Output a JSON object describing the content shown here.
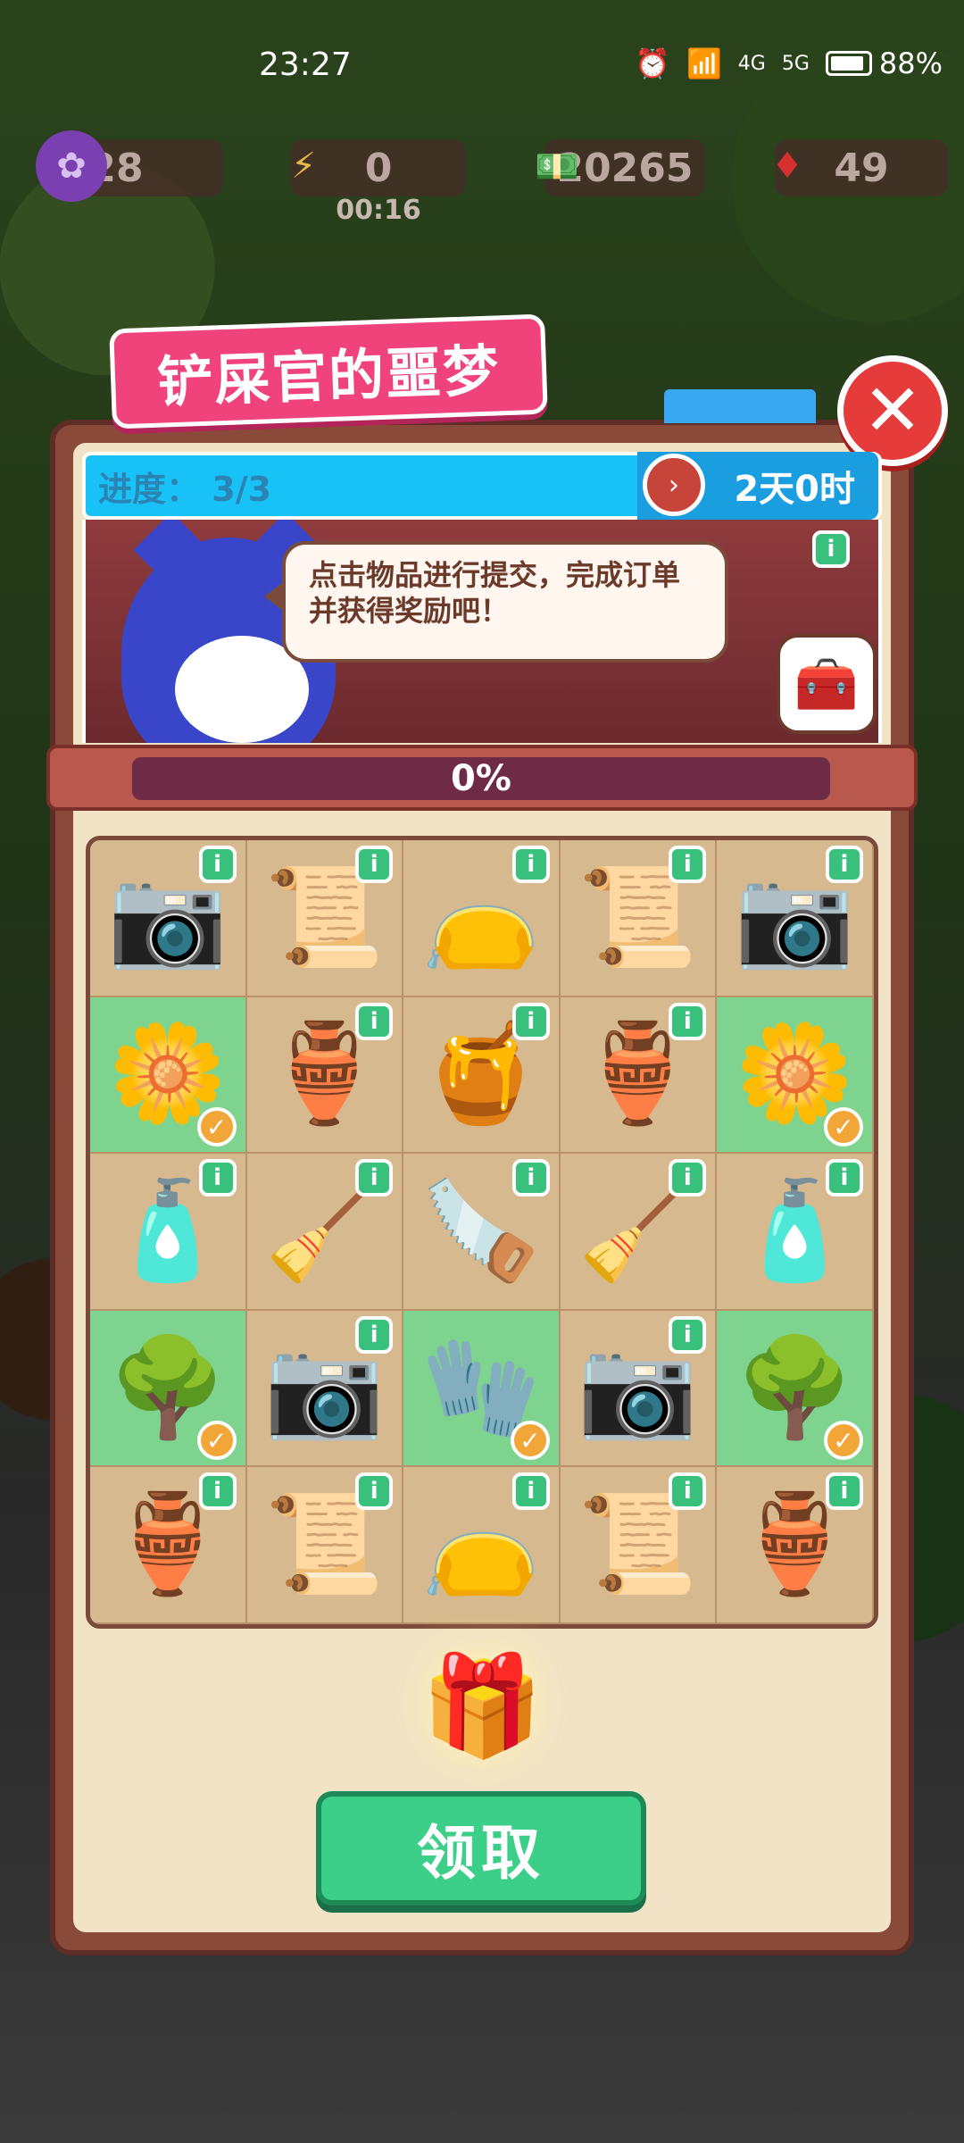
{
  "status_bar": {
    "time": "23:27",
    "network_labels": [
      "4G",
      "5G"
    ],
    "battery": "88%"
  },
  "resources": {
    "level": "28",
    "energy": "0",
    "energy_timer": "00:16",
    "cash": "20265",
    "gems": "49"
  },
  "event": {
    "title": "铲屎官的噩梦",
    "progress_label": "进度：",
    "progress_value": "3/3",
    "timer": "2天0时",
    "speech": "点击物品进行提交，完成订单并获得奖励吧！",
    "progress_percent": "0%"
  },
  "grid": {
    "rows": [
      [
        {
          "icon": "camera",
          "glyph": "📷",
          "done": false
        },
        {
          "icon": "poster",
          "glyph": "📜",
          "done": false
        },
        {
          "icon": "pouch",
          "glyph": "👝",
          "done": false
        },
        {
          "icon": "poster",
          "glyph": "📜",
          "done": false
        },
        {
          "icon": "camera",
          "glyph": "📷",
          "done": false
        }
      ],
      [
        {
          "icon": "cotton-flower",
          "glyph": "🌼",
          "done": true
        },
        {
          "icon": "vase",
          "glyph": "🏺",
          "done": false
        },
        {
          "icon": "honey-jar",
          "glyph": "🍯",
          "done": false
        },
        {
          "icon": "vase",
          "glyph": "🏺",
          "done": false
        },
        {
          "icon": "cotton-flower",
          "glyph": "🌼",
          "done": true
        }
      ],
      [
        {
          "icon": "soap-bottle",
          "glyph": "🧴",
          "done": false
        },
        {
          "icon": "broom",
          "glyph": "🧹",
          "done": false
        },
        {
          "icon": "hacksaw",
          "glyph": "🪚",
          "done": false
        },
        {
          "icon": "broom",
          "glyph": "🧹",
          "done": false
        },
        {
          "icon": "soap-bottle",
          "glyph": "🧴",
          "done": false
        }
      ],
      [
        {
          "icon": "bonsai-tree",
          "glyph": "🌳",
          "done": true
        },
        {
          "icon": "camera",
          "glyph": "📷",
          "done": false
        },
        {
          "icon": "gloves",
          "glyph": "🧤",
          "done": true
        },
        {
          "icon": "camera",
          "glyph": "📷",
          "done": false
        },
        {
          "icon": "bonsai-tree",
          "glyph": "🌳",
          "done": true
        }
      ],
      [
        {
          "icon": "vase",
          "glyph": "🏺",
          "done": false
        },
        {
          "icon": "poster",
          "glyph": "📜",
          "done": false
        },
        {
          "icon": "pouch",
          "glyph": "👝",
          "done": false
        },
        {
          "icon": "poster",
          "glyph": "📜",
          "done": false
        },
        {
          "icon": "vase",
          "glyph": "🏺",
          "done": false
        }
      ]
    ],
    "info_badge": "i",
    "check_mark": "✓"
  },
  "buttons": {
    "claim_label": "领取",
    "close_glyph": "✕"
  },
  "colors": {
    "title_pink": "#f0437b",
    "header_blue": "#18c2f6",
    "claim_green": "#3ccf89",
    "done_cell": "#7ed38e"
  }
}
